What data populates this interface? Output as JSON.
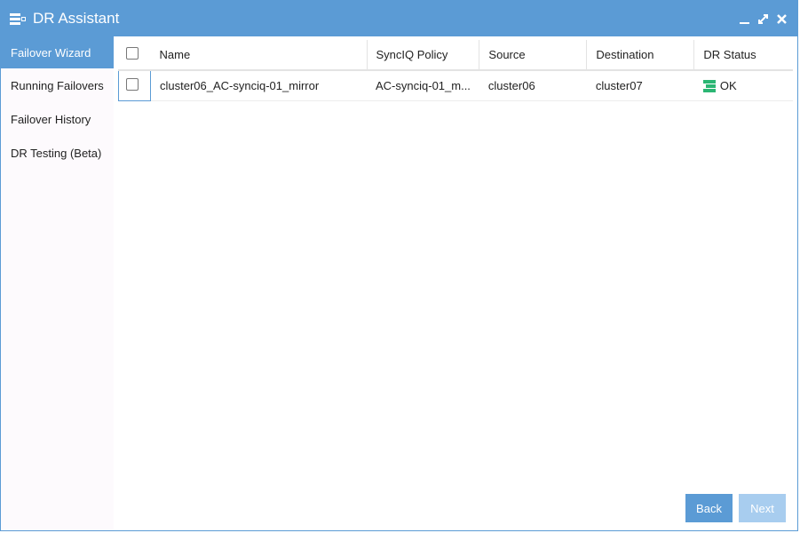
{
  "window": {
    "title": "DR Assistant"
  },
  "sidebar": {
    "items": [
      {
        "label": "Failover Wizard"
      },
      {
        "label": "Running Failovers"
      },
      {
        "label": "Failover History"
      },
      {
        "label": "DR Testing (Beta)"
      }
    ]
  },
  "table": {
    "headers": [
      "Name",
      "SyncIQ Policy",
      "Source",
      "Destination",
      "DR Status"
    ],
    "rows": [
      {
        "name": "cluster06_AC-synciq-01_mirror",
        "policy": "AC-synciq-01_m...",
        "source": "cluster06",
        "destination": "cluster07",
        "status": "OK"
      }
    ]
  },
  "buttons": {
    "back": "Back",
    "next": "Next"
  },
  "colors": {
    "accent": "#5b9bd5",
    "status_ok": "#2bb673"
  }
}
